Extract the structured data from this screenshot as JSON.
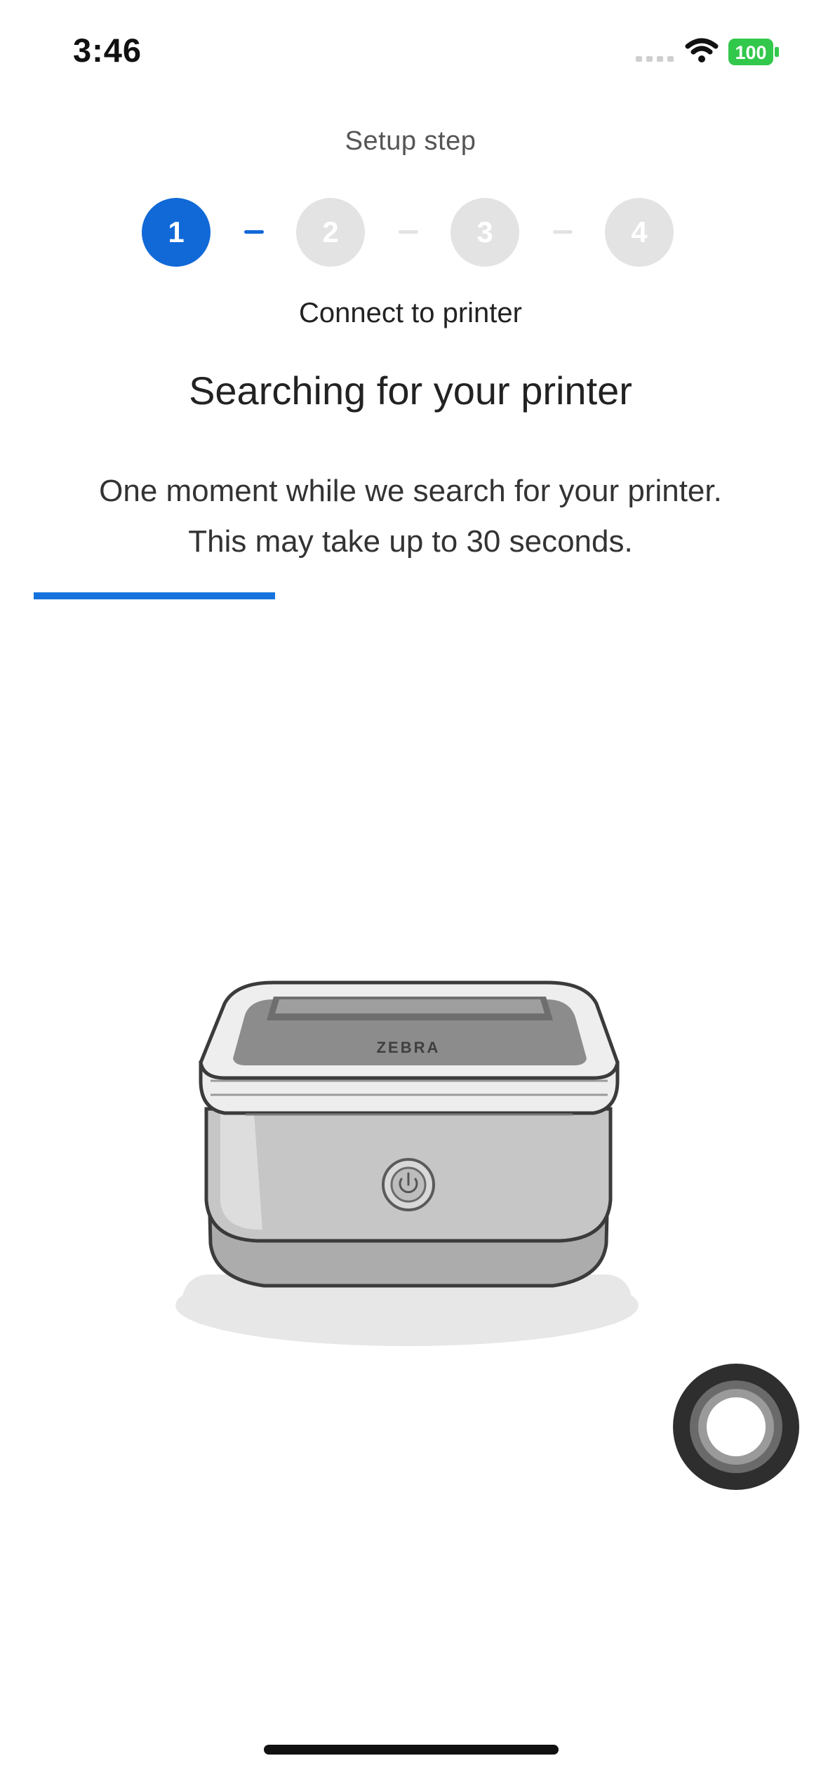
{
  "status_bar": {
    "time": "3:46",
    "battery": "100",
    "icons": [
      "signal-icon",
      "wifi-icon",
      "battery-icon"
    ]
  },
  "setup": {
    "label": "Setup step",
    "steps": [
      {
        "number": "1",
        "active": true
      },
      {
        "number": "2",
        "active": false
      },
      {
        "number": "3",
        "active": false
      },
      {
        "number": "4",
        "active": false
      }
    ],
    "current_step_name": "Connect to printer"
  },
  "main": {
    "headline": "Searching for your printer",
    "description_line1": "One moment while we search for your printer.",
    "description_line2": "This may take up to 30 seconds.",
    "progress": 0.32
  },
  "illustration": {
    "printer_brand": "ZEBRA"
  },
  "colors": {
    "accent": "#1169d8",
    "inactive_step": "#e3e3e3",
    "text": "#222222"
  }
}
